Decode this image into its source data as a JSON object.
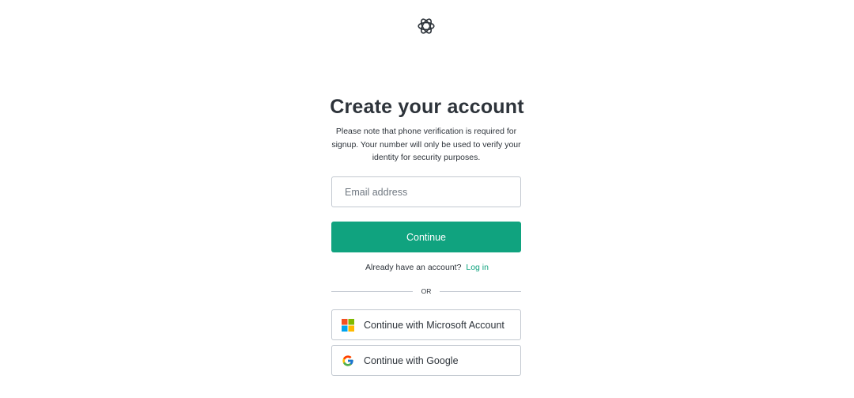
{
  "page": {
    "title": "Create your account",
    "note": "Please note that phone verification is required for signup. Your number will only be used to verify your identity for security purposes."
  },
  "form": {
    "email_placeholder": "Email address",
    "email_value": "",
    "continue_label": "Continue"
  },
  "login": {
    "prompt": "Already have an account?",
    "link_label": "Log in"
  },
  "divider": {
    "label": "OR"
  },
  "social": [
    {
      "label": "Continue with Microsoft Account",
      "icon": "microsoft-icon"
    },
    {
      "label": "Continue with Google",
      "icon": "google-icon"
    }
  ],
  "colors": {
    "accent": "#10a37f",
    "text": "#2d333a",
    "border": "#c2c8d0",
    "placeholder": "#6f7780"
  },
  "icons": {
    "logo": "openai-logo-icon"
  }
}
